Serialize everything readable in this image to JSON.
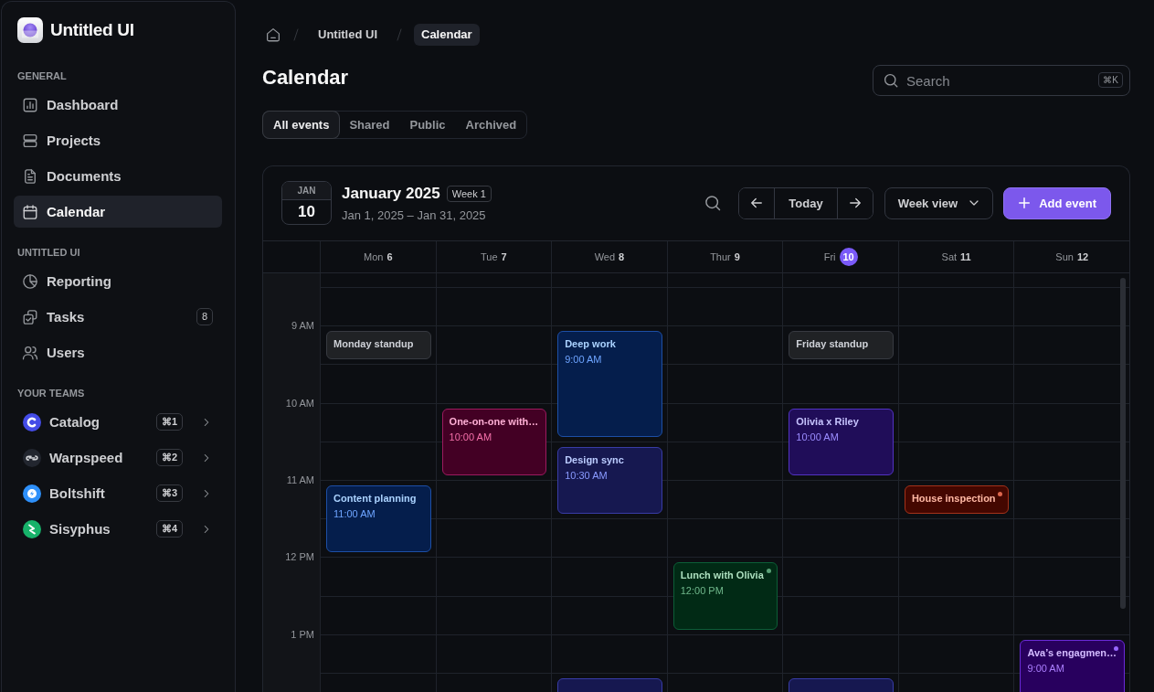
{
  "sidebar": {
    "brand": "Untitled UI",
    "sections": [
      {
        "title": "GENERAL",
        "items": [
          {
            "label": "Dashboard",
            "selected": false
          },
          {
            "label": "Projects",
            "selected": false
          },
          {
            "label": "Documents",
            "selected": false
          },
          {
            "label": "Calendar",
            "selected": true
          }
        ]
      },
      {
        "title": "UNTITLED UI",
        "items": [
          {
            "label": "Reporting",
            "selected": false
          },
          {
            "label": "Tasks",
            "selected": false,
            "badge": "8"
          },
          {
            "label": "Users",
            "selected": false
          }
        ]
      }
    ],
    "teams_title": "YOUR TEAMS",
    "teams": [
      {
        "name": "Catalog",
        "shortcut": "⌘1",
        "color": "#444ce7"
      },
      {
        "name": "Warpspeed",
        "shortcut": "⌘2",
        "color": "#22262f"
      },
      {
        "name": "Boltshift",
        "shortcut": "⌘3",
        "color": "#2e90fa"
      },
      {
        "name": "Sisyphus",
        "shortcut": "⌘4",
        "color": "#17b26a"
      }
    ]
  },
  "breadcrumb": [
    {
      "label": "Untitled UI",
      "current": false
    },
    {
      "label": "Calendar",
      "current": true
    }
  ],
  "page_title": "Calendar",
  "search": {
    "placeholder": "Search",
    "shortcut": "⌘K"
  },
  "tabs": [
    {
      "label": "All events",
      "selected": true
    },
    {
      "label": "Shared",
      "selected": false
    },
    {
      "label": "Public",
      "selected": false
    },
    {
      "label": "Archived",
      "selected": false
    }
  ],
  "calendar": {
    "date_badge": {
      "month": "JAN",
      "day": "10"
    },
    "title": "January 2025",
    "week": "Week 1",
    "range": "Jan 1, 2025 – Jan 31, 2025",
    "today_button": "Today",
    "view_select": "Week view",
    "add_button": "Add event",
    "days": [
      {
        "name": "Mon",
        "date": "6",
        "today": false
      },
      {
        "name": "Tue",
        "date": "7",
        "today": false
      },
      {
        "name": "Wed",
        "date": "8",
        "today": false
      },
      {
        "name": "Thur",
        "date": "9",
        "today": false
      },
      {
        "name": "Fri",
        "date": "10",
        "today": true
      },
      {
        "name": "Sat",
        "date": "11",
        "today": false
      },
      {
        "name": "Sun",
        "date": "12",
        "today": false
      }
    ],
    "rows": [
      {
        "cells": [
          {
            "busy": false
          },
          {
            "busy": false
          },
          {
            "busy": false
          },
          {
            "busy": false
          },
          {
            "busy": false
          },
          {
            "busy": false
          },
          {
            "busy": false
          }
        ]
      },
      {
        "cells": [
          {
            "busy": false
          },
          {
            "busy": false
          },
          {
            "busy": false
          },
          {
            "busy": false
          },
          {
            "busy": false
          },
          {
            "busy": false
          },
          {
            "busy": false
          }
        ]
      },
      {
        "label": "9 AM",
        "cells": [
          {
            "busy": true,
            "event": {
              "title": "Monday standup",
              "color": "#373a41",
              "dot": false
            }
          },
          {
            "busy": false
          },
          {
            "busy": true,
            "event": {
              "title": "Deep work",
              "time": "9:00 AM",
              "color": "#1d4fa6",
              "dot": false
            }
          },
          {
            "busy": false
          },
          {
            "busy": true,
            "event": {
              "title": "Friday standup",
              "color": "#373a41",
              "dot": false
            }
          },
          {
            "busy": false
          },
          {
            "busy": false
          }
        ]
      },
      {
        "cells": [
          {
            "busy": false
          },
          {
            "busy": false
          },
          {
            "busy": true
          },
          {
            "busy": false
          },
          {
            "busy": false
          },
          {
            "busy": false
          },
          {
            "busy": false
          }
        ]
      },
      {
        "label": "10 AM",
        "cells": [
          {
            "busy": false
          },
          {
            "busy": true,
            "event": {
              "title": "One-on-one with…",
              "time": "10:00 AM",
              "color": "#9c1a5e",
              "dot": false
            }
          },
          {
            "busy": true
          },
          {
            "busy": false
          },
          {
            "busy": true,
            "event": {
              "title": "Olivia x Riley",
              "time": "10:00 AM",
              "color": "#5233c2",
              "dot": false
            }
          },
          {
            "busy": false
          },
          {
            "busy": false
          }
        ]
      },
      {
        "cells": [
          {
            "busy": false
          },
          {
            "busy": true
          },
          {
            "busy": true,
            "event": {
              "title": "Design sync",
              "time": "10:30 AM",
              "color": "#383ca6",
              "dot": false
            }
          },
          {
            "busy": false
          },
          {
            "busy": true
          },
          {
            "busy": false
          },
          {
            "busy": false
          }
        ]
      },
      {
        "label": "11 AM",
        "cells": [
          {
            "busy": true,
            "event": {
              "title": "Content planning",
              "time": "11:00 AM",
              "color": "#1d4fa6",
              "dot": false
            }
          },
          {
            "busy": false
          },
          {
            "busy": true
          },
          {
            "busy": false
          },
          {
            "busy": false
          },
          {
            "busy": true,
            "event": {
              "title": "House inspection",
              "color": "#a3321a",
              "dot": true
            }
          },
          {
            "busy": false
          }
        ]
      },
      {
        "cells": [
          {
            "busy": true
          },
          {
            "busy": false
          },
          {
            "busy": false
          },
          {
            "busy": false
          },
          {
            "busy": false
          },
          {
            "busy": false
          },
          {
            "busy": false
          }
        ]
      },
      {
        "label": "12 PM",
        "cells": [
          {
            "busy": false
          },
          {
            "busy": false
          },
          {
            "busy": false
          },
          {
            "busy": true,
            "event": {
              "title": "Lunch with Olivia",
              "time": "12:00 PM",
              "color": "#0c5e37",
              "dot": true
            }
          },
          {
            "busy": false
          },
          {
            "busy": false
          },
          {
            "busy": false
          }
        ]
      },
      {
        "cells": [
          {
            "busy": false
          },
          {
            "busy": false
          },
          {
            "busy": false
          },
          {
            "busy": true
          },
          {
            "busy": false
          },
          {
            "busy": false
          },
          {
            "busy": false
          }
        ]
      },
      {
        "label": "1 PM",
        "cells": [
          {
            "busy": false
          },
          {
            "busy": false
          },
          {
            "busy": false
          },
          {
            "busy": false
          },
          {
            "busy": false
          },
          {
            "busy": false
          },
          {
            "busy": true,
            "event": {
              "title": "Ava’s engagmen…",
              "time": "9:00 AM",
              "color": "#6a2ad8",
              "dot": true
            }
          }
        ]
      },
      {
        "cells": [
          {
            "busy": false
          },
          {
            "busy": false
          },
          {
            "busy": true,
            "event": {
              "color": "#383ca6",
              "dot": false
            }
          },
          {
            "busy": false
          },
          {
            "busy": true,
            "event": {
              "color": "#383ca6",
              "dot": false
            }
          },
          {
            "busy": false
          },
          {
            "busy": true
          }
        ]
      }
    ]
  }
}
